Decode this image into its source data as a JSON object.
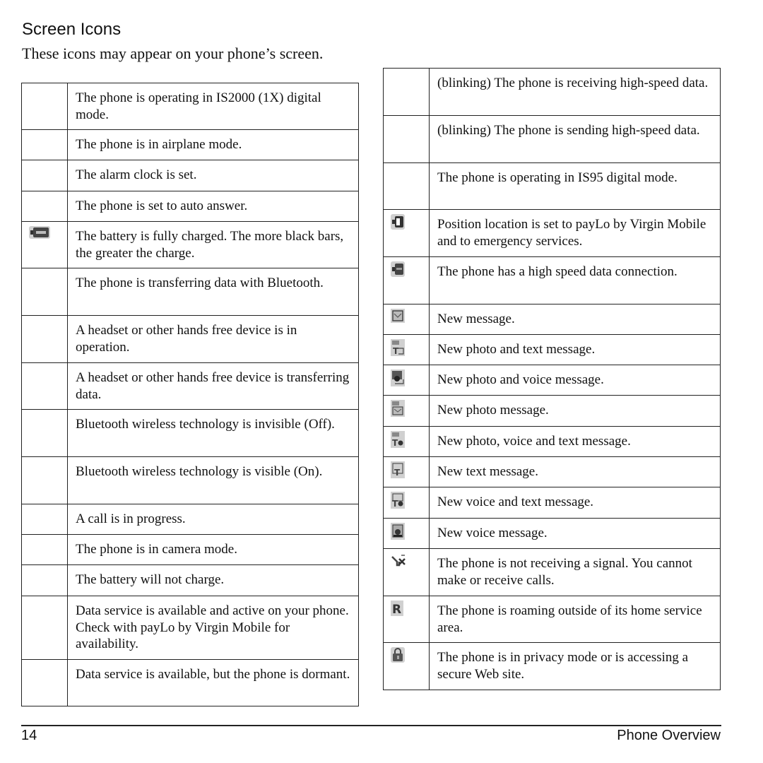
{
  "page": {
    "title": "Screen Icons",
    "intro": "These icons may appear on your phone’s screen."
  },
  "left_table": [
    {
      "icon": "",
      "text": "The phone is operating in IS2000 (1X) digital mode."
    },
    {
      "icon": "",
      "text": "The phone is in airplane mode."
    },
    {
      "icon": "",
      "text": "The alarm clock is set."
    },
    {
      "icon": "",
      "text": "The phone is set to auto answer."
    },
    {
      "icon": "battery-full-icon",
      "text": "The battery is fully charged. The more black bars, the greater the charge."
    },
    {
      "icon": "",
      "text": "The phone is transferring data with Bluetooth."
    },
    {
      "icon": "",
      "text": "A headset or other hands free device is in operation."
    },
    {
      "icon": "",
      "text": "A headset or other hands free device is transferring data."
    },
    {
      "icon": "",
      "text": "Bluetooth wireless technology is invisible (Off)."
    },
    {
      "icon": "",
      "text": "Bluetooth wireless technology is visible (On)."
    },
    {
      "icon": "",
      "text": "A call is in progress."
    },
    {
      "icon": "",
      "text": "The phone is in camera mode."
    },
    {
      "icon": "",
      "text": "The battery will not charge."
    },
    {
      "icon": "",
      "text": "Data service is available and active on your phone. Check with payLo by Virgin Mobile for availability."
    },
    {
      "icon": "",
      "text": "Data service is available, but the phone is dormant."
    }
  ],
  "right_table": [
    {
      "icon": "",
      "text": "(blinking) The phone is receiving high-speed data."
    },
    {
      "icon": "",
      "text": "(blinking) The phone is sending high-speed data."
    },
    {
      "icon": "",
      "text": "The phone is operating in IS95 digital mode."
    },
    {
      "icon": "position-location-icon",
      "text": "Position location is set to payLo by Virgin Mobile and to emergency services."
    },
    {
      "icon": "high-speed-data-icon",
      "text": "The phone has a high speed data connection."
    },
    {
      "icon": "new-message-icon",
      "text": "New message."
    },
    {
      "icon": "photo-text-message-icon",
      "text": "New photo and text message."
    },
    {
      "icon": "photo-voice-message-icon",
      "text": "New photo and voice message."
    },
    {
      "icon": "photo-message-icon",
      "text": "New photo message."
    },
    {
      "icon": "photo-voice-text-message-icon",
      "text": "New photo, voice and text message."
    },
    {
      "icon": "text-message-icon",
      "text": "New text message."
    },
    {
      "icon": "voice-text-message-icon",
      "text": "New voice and text message."
    },
    {
      "icon": "voice-message-icon",
      "text": "New voice message."
    },
    {
      "icon": "no-signal-icon",
      "text": "The phone is not receiving a signal. You cannot make or receive calls."
    },
    {
      "icon": "roaming-icon",
      "text": "The phone is roaming outside of its home service area."
    },
    {
      "icon": "privacy-lock-icon",
      "text": "The phone is in privacy mode or is accessing a secure Web site."
    }
  ],
  "footer": {
    "page_number": "14",
    "section": "Phone Overview"
  }
}
